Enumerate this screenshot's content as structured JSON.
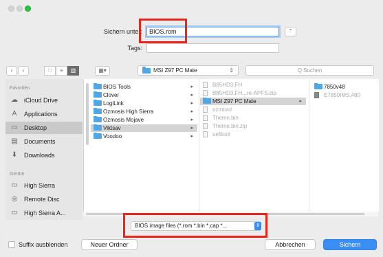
{
  "window": {
    "title": ""
  },
  "save": {
    "label": "Sichern unter:",
    "filename": "BIOS.rom",
    "tags_label": "Tags:",
    "tags_value": ""
  },
  "toolbar": {
    "back": "‹",
    "forward": "›",
    "path": "MSI Z97 PC Mate",
    "search_placeholder": "Q Suchen"
  },
  "sidebar": {
    "favorites_header": "Favoriten",
    "devices_header": "Geräte",
    "favorites": [
      {
        "label": "iCloud Drive",
        "icon": "cloud-icon"
      },
      {
        "label": "Applications",
        "icon": "applications-icon"
      },
      {
        "label": "Desktop",
        "icon": "desktop-icon"
      },
      {
        "label": "Documents",
        "icon": "documents-icon"
      },
      {
        "label": "Downloads",
        "icon": "downloads-icon"
      }
    ],
    "devices": [
      {
        "label": "High Sierra",
        "icon": "disk-icon"
      },
      {
        "label": "Remote Disc",
        "icon": "disc-icon"
      },
      {
        "label": "High Sierra A...",
        "icon": "disk-icon"
      }
    ]
  },
  "columns": {
    "col1": [
      "BIOS Tools",
      "Clover",
      "LogiLink",
      "Ozmosis High Sierra",
      "Ozmosis Mojave",
      "Viktsav",
      "Voodoo"
    ],
    "col2": [
      "B85HD3.FH",
      "B85HD3.FH...re-APFS.zip",
      "MSI Z97 PC Mate",
      "ozmtool",
      "Theme.bin",
      "Theme.bin.zip",
      "uefitool"
    ],
    "col3": [
      "7850v48",
      "E7850IMS.480"
    ]
  },
  "format": {
    "selected": "BIOS image files (*.rom *.bin *.cap *..."
  },
  "bottom": {
    "hide_ext_label": "Suffix ausblenden",
    "new_folder": "Neuer Ordner",
    "cancel": "Abbrechen",
    "save": "Sichern"
  },
  "colors": {
    "accent": "#3d8ef3",
    "highlight_box": "#e8261b",
    "folder": "#4fa7e6"
  }
}
